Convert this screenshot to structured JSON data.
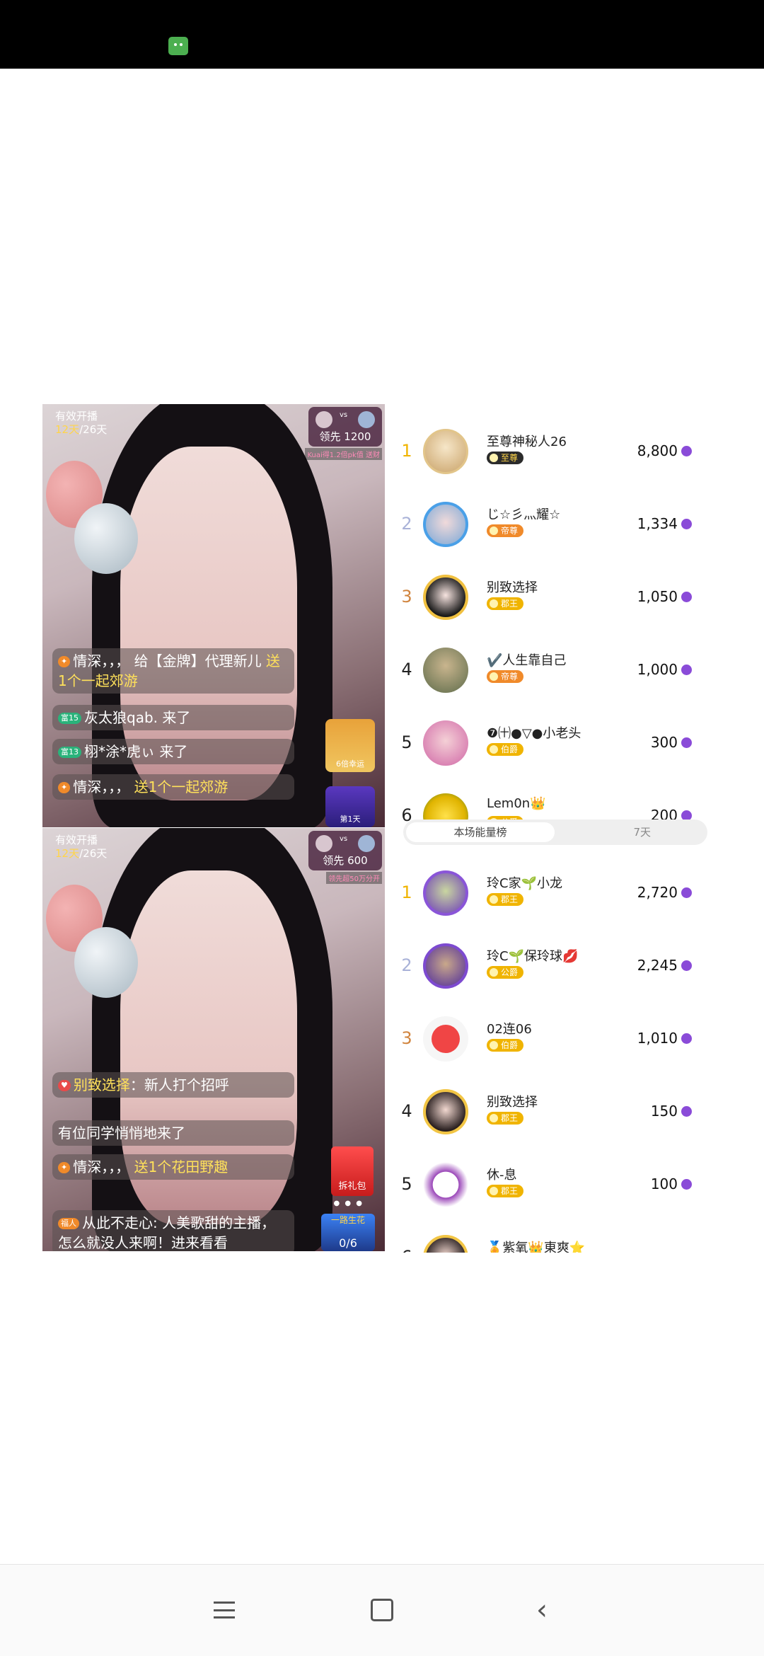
{
  "stream1": {
    "label_top": "有效开播",
    "days": "12天",
    "days_total": "/26天",
    "pk_vs": "vs",
    "pk_lead": "领先 1200",
    "pk_sub": "Kuai得1.2倍pk值  送财",
    "chat": [
      {
        "tag": "",
        "user": "情深，，，",
        "text": "给【金牌】代理新儿",
        "highlight": "送1个一起郊游"
      },
      {
        "tag": "富15",
        "text": "灰太狼qab. 来了"
      },
      {
        "tag": "富13",
        "text": "栩*涂*虎ぃ 来了"
      },
      {
        "tag": "",
        "user": "情深，，，",
        "highlight": "送1个一起郊游"
      }
    ],
    "promo1": "6倍幸运",
    "promo2": "第1天"
  },
  "stream2": {
    "label_top": "有效开播",
    "days": "12天",
    "days_total": "/26天",
    "pk_vs": "vs",
    "pk_lead": "领先 600",
    "pk_sub": "领先超50万分开",
    "chat": [
      {
        "user": "别致选择",
        "text": "：新人打个招呼"
      },
      {
        "text": "有位同学悄悄地来了"
      },
      {
        "user": "情深，，，",
        "highlight": "送1个花田野趣"
      },
      {
        "tag": "福人",
        "text": "从此不走心: 人美歌甜的主播，怎么就没人来啊！进来看看"
      }
    ],
    "gift_label": "拆礼包",
    "promo_title": "一路生花",
    "promo_frac": "0/6"
  },
  "leaderboard1": [
    {
      "rank": "1",
      "name": "至尊神秘人26",
      "badge": "至尊",
      "score": "8,800"
    },
    {
      "rank": "2",
      "name": "じ☆彡灬耀☆",
      "badge": "帝尊",
      "score": "1,334"
    },
    {
      "rank": "3",
      "name": "别致选择",
      "badge": "郡王",
      "score": "1,050"
    },
    {
      "rank": "4",
      "name": "✔️人生靠自己",
      "badge": "帝尊",
      "score": "1,000"
    },
    {
      "rank": "5",
      "name": "❼㈩●▽●小老头",
      "badge": "伯爵",
      "score": "300"
    },
    {
      "rank": "6",
      "name": "Lem0n👑",
      "badge": "公爵",
      "score": "200"
    }
  ],
  "tabs": {
    "active": "本场能量榜",
    "other": "7天"
  },
  "leaderboard2": [
    {
      "rank": "1",
      "name": "玲C家🌱小龙",
      "badge": "郡王",
      "score": "2,720"
    },
    {
      "rank": "2",
      "name": "玲C🌱保玲球💋",
      "badge": "公爵",
      "score": "2,245"
    },
    {
      "rank": "3",
      "name": "02连06",
      "badge": "伯爵",
      "score": "1,010"
    },
    {
      "rank": "4",
      "name": "别致选择",
      "badge": "郡王",
      "score": "150"
    },
    {
      "rank": "5",
      "name": "休-息",
      "badge": "郡王",
      "score": "100"
    },
    {
      "rank": "6",
      "name": "🏅紫氧👑東爽⭐",
      "badge": "",
      "score": ""
    }
  ],
  "nav": {
    "menu": "menu",
    "home": "home",
    "back": "back"
  }
}
